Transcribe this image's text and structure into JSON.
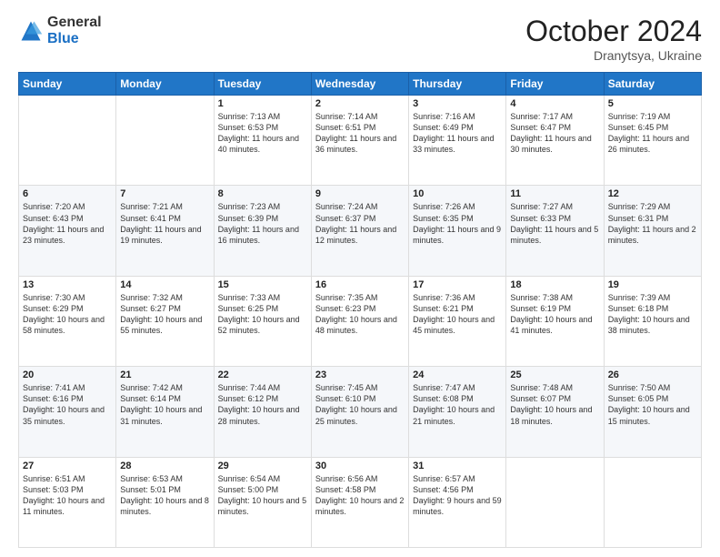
{
  "logo": {
    "general": "General",
    "blue": "Blue",
    "arrow_icon": "▶"
  },
  "header": {
    "month": "October 2024",
    "location": "Dranytsya, Ukraine"
  },
  "weekdays": [
    "Sunday",
    "Monday",
    "Tuesday",
    "Wednesday",
    "Thursday",
    "Friday",
    "Saturday"
  ],
  "weeks": [
    [
      {
        "day": "",
        "content": ""
      },
      {
        "day": "",
        "content": ""
      },
      {
        "day": "1",
        "content": "Sunrise: 7:13 AM\nSunset: 6:53 PM\nDaylight: 11 hours and 40 minutes."
      },
      {
        "day": "2",
        "content": "Sunrise: 7:14 AM\nSunset: 6:51 PM\nDaylight: 11 hours and 36 minutes."
      },
      {
        "day": "3",
        "content": "Sunrise: 7:16 AM\nSunset: 6:49 PM\nDaylight: 11 hours and 33 minutes."
      },
      {
        "day": "4",
        "content": "Sunrise: 7:17 AM\nSunset: 6:47 PM\nDaylight: 11 hours and 30 minutes."
      },
      {
        "day": "5",
        "content": "Sunrise: 7:19 AM\nSunset: 6:45 PM\nDaylight: 11 hours and 26 minutes."
      }
    ],
    [
      {
        "day": "6",
        "content": "Sunrise: 7:20 AM\nSunset: 6:43 PM\nDaylight: 11 hours and 23 minutes."
      },
      {
        "day": "7",
        "content": "Sunrise: 7:21 AM\nSunset: 6:41 PM\nDaylight: 11 hours and 19 minutes."
      },
      {
        "day": "8",
        "content": "Sunrise: 7:23 AM\nSunset: 6:39 PM\nDaylight: 11 hours and 16 minutes."
      },
      {
        "day": "9",
        "content": "Sunrise: 7:24 AM\nSunset: 6:37 PM\nDaylight: 11 hours and 12 minutes."
      },
      {
        "day": "10",
        "content": "Sunrise: 7:26 AM\nSunset: 6:35 PM\nDaylight: 11 hours and 9 minutes."
      },
      {
        "day": "11",
        "content": "Sunrise: 7:27 AM\nSunset: 6:33 PM\nDaylight: 11 hours and 5 minutes."
      },
      {
        "day": "12",
        "content": "Sunrise: 7:29 AM\nSunset: 6:31 PM\nDaylight: 11 hours and 2 minutes."
      }
    ],
    [
      {
        "day": "13",
        "content": "Sunrise: 7:30 AM\nSunset: 6:29 PM\nDaylight: 10 hours and 58 minutes."
      },
      {
        "day": "14",
        "content": "Sunrise: 7:32 AM\nSunset: 6:27 PM\nDaylight: 10 hours and 55 minutes."
      },
      {
        "day": "15",
        "content": "Sunrise: 7:33 AM\nSunset: 6:25 PM\nDaylight: 10 hours and 52 minutes."
      },
      {
        "day": "16",
        "content": "Sunrise: 7:35 AM\nSunset: 6:23 PM\nDaylight: 10 hours and 48 minutes."
      },
      {
        "day": "17",
        "content": "Sunrise: 7:36 AM\nSunset: 6:21 PM\nDaylight: 10 hours and 45 minutes."
      },
      {
        "day": "18",
        "content": "Sunrise: 7:38 AM\nSunset: 6:19 PM\nDaylight: 10 hours and 41 minutes."
      },
      {
        "day": "19",
        "content": "Sunrise: 7:39 AM\nSunset: 6:18 PM\nDaylight: 10 hours and 38 minutes."
      }
    ],
    [
      {
        "day": "20",
        "content": "Sunrise: 7:41 AM\nSunset: 6:16 PM\nDaylight: 10 hours and 35 minutes."
      },
      {
        "day": "21",
        "content": "Sunrise: 7:42 AM\nSunset: 6:14 PM\nDaylight: 10 hours and 31 minutes."
      },
      {
        "day": "22",
        "content": "Sunrise: 7:44 AM\nSunset: 6:12 PM\nDaylight: 10 hours and 28 minutes."
      },
      {
        "day": "23",
        "content": "Sunrise: 7:45 AM\nSunset: 6:10 PM\nDaylight: 10 hours and 25 minutes."
      },
      {
        "day": "24",
        "content": "Sunrise: 7:47 AM\nSunset: 6:08 PM\nDaylight: 10 hours and 21 minutes."
      },
      {
        "day": "25",
        "content": "Sunrise: 7:48 AM\nSunset: 6:07 PM\nDaylight: 10 hours and 18 minutes."
      },
      {
        "day": "26",
        "content": "Sunrise: 7:50 AM\nSunset: 6:05 PM\nDaylight: 10 hours and 15 minutes."
      }
    ],
    [
      {
        "day": "27",
        "content": "Sunrise: 6:51 AM\nSunset: 5:03 PM\nDaylight: 10 hours and 11 minutes."
      },
      {
        "day": "28",
        "content": "Sunrise: 6:53 AM\nSunset: 5:01 PM\nDaylight: 10 hours and 8 minutes."
      },
      {
        "day": "29",
        "content": "Sunrise: 6:54 AM\nSunset: 5:00 PM\nDaylight: 10 hours and 5 minutes."
      },
      {
        "day": "30",
        "content": "Sunrise: 6:56 AM\nSunset: 4:58 PM\nDaylight: 10 hours and 2 minutes."
      },
      {
        "day": "31",
        "content": "Sunrise: 6:57 AM\nSunset: 4:56 PM\nDaylight: 9 hours and 59 minutes."
      },
      {
        "day": "",
        "content": ""
      },
      {
        "day": "",
        "content": ""
      }
    ]
  ]
}
